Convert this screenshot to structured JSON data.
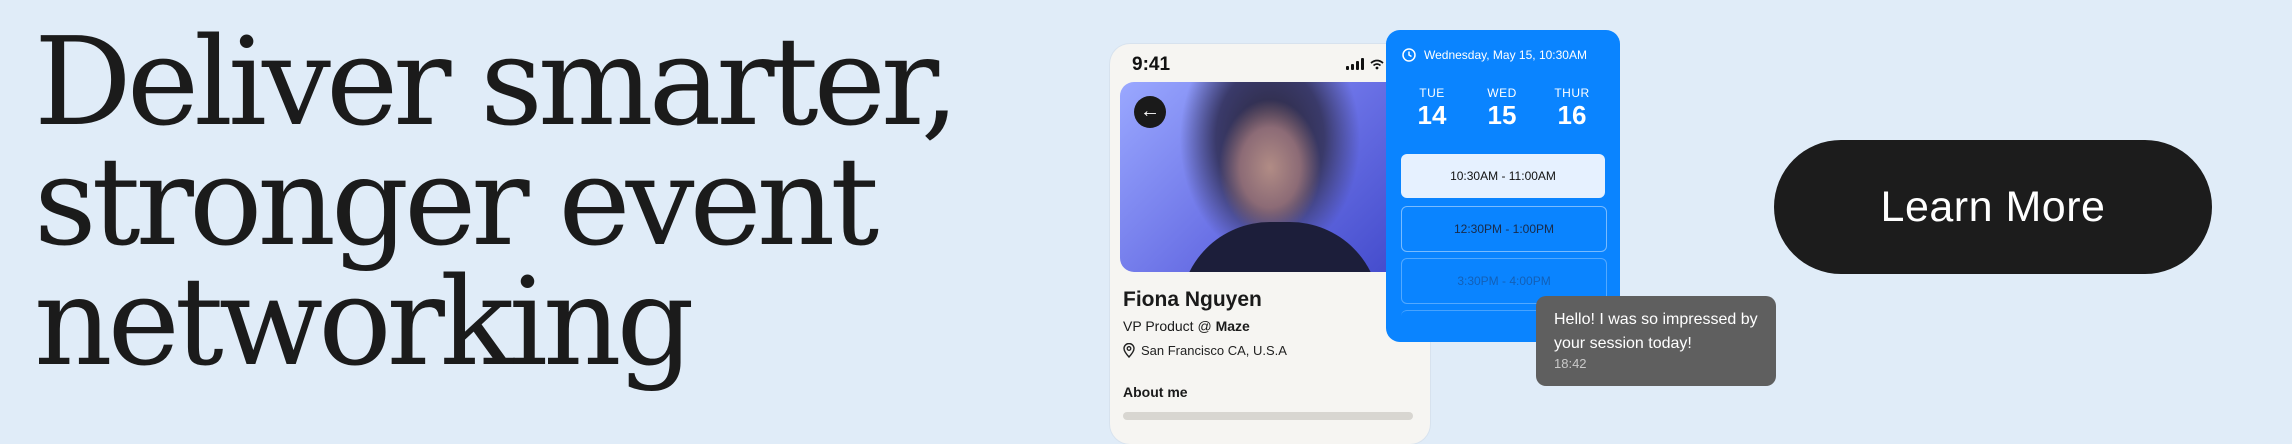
{
  "headline": {
    "line1": "Deliver smarter,",
    "line2": "stronger event",
    "line3": "networking"
  },
  "phone": {
    "time": "9:41",
    "profile": {
      "name": "Fiona Nguyen",
      "role_prefix": "VP Product @ ",
      "company": "Maze",
      "location": "San Francisco CA, U.S.A",
      "about_heading": "About me"
    }
  },
  "calendar": {
    "datetime": "Wednesday, May 15, 10:30AM",
    "days": [
      {
        "label": "TUE",
        "number": "14"
      },
      {
        "label": "WED",
        "number": "15"
      },
      {
        "label": "THUR",
        "number": "16"
      }
    ],
    "slots": [
      "10:30AM - 11:00AM",
      "12:30PM - 1:00PM",
      "3:30PM - 4:00PM"
    ]
  },
  "chat": {
    "message": "Hello! I was so impressed by your session today!",
    "time": "18:42"
  },
  "cta": {
    "label": "Learn More"
  },
  "colors": {
    "background": "#e0ecf8",
    "accent": "#0a84ff",
    "cta": "#1c1c1c"
  }
}
